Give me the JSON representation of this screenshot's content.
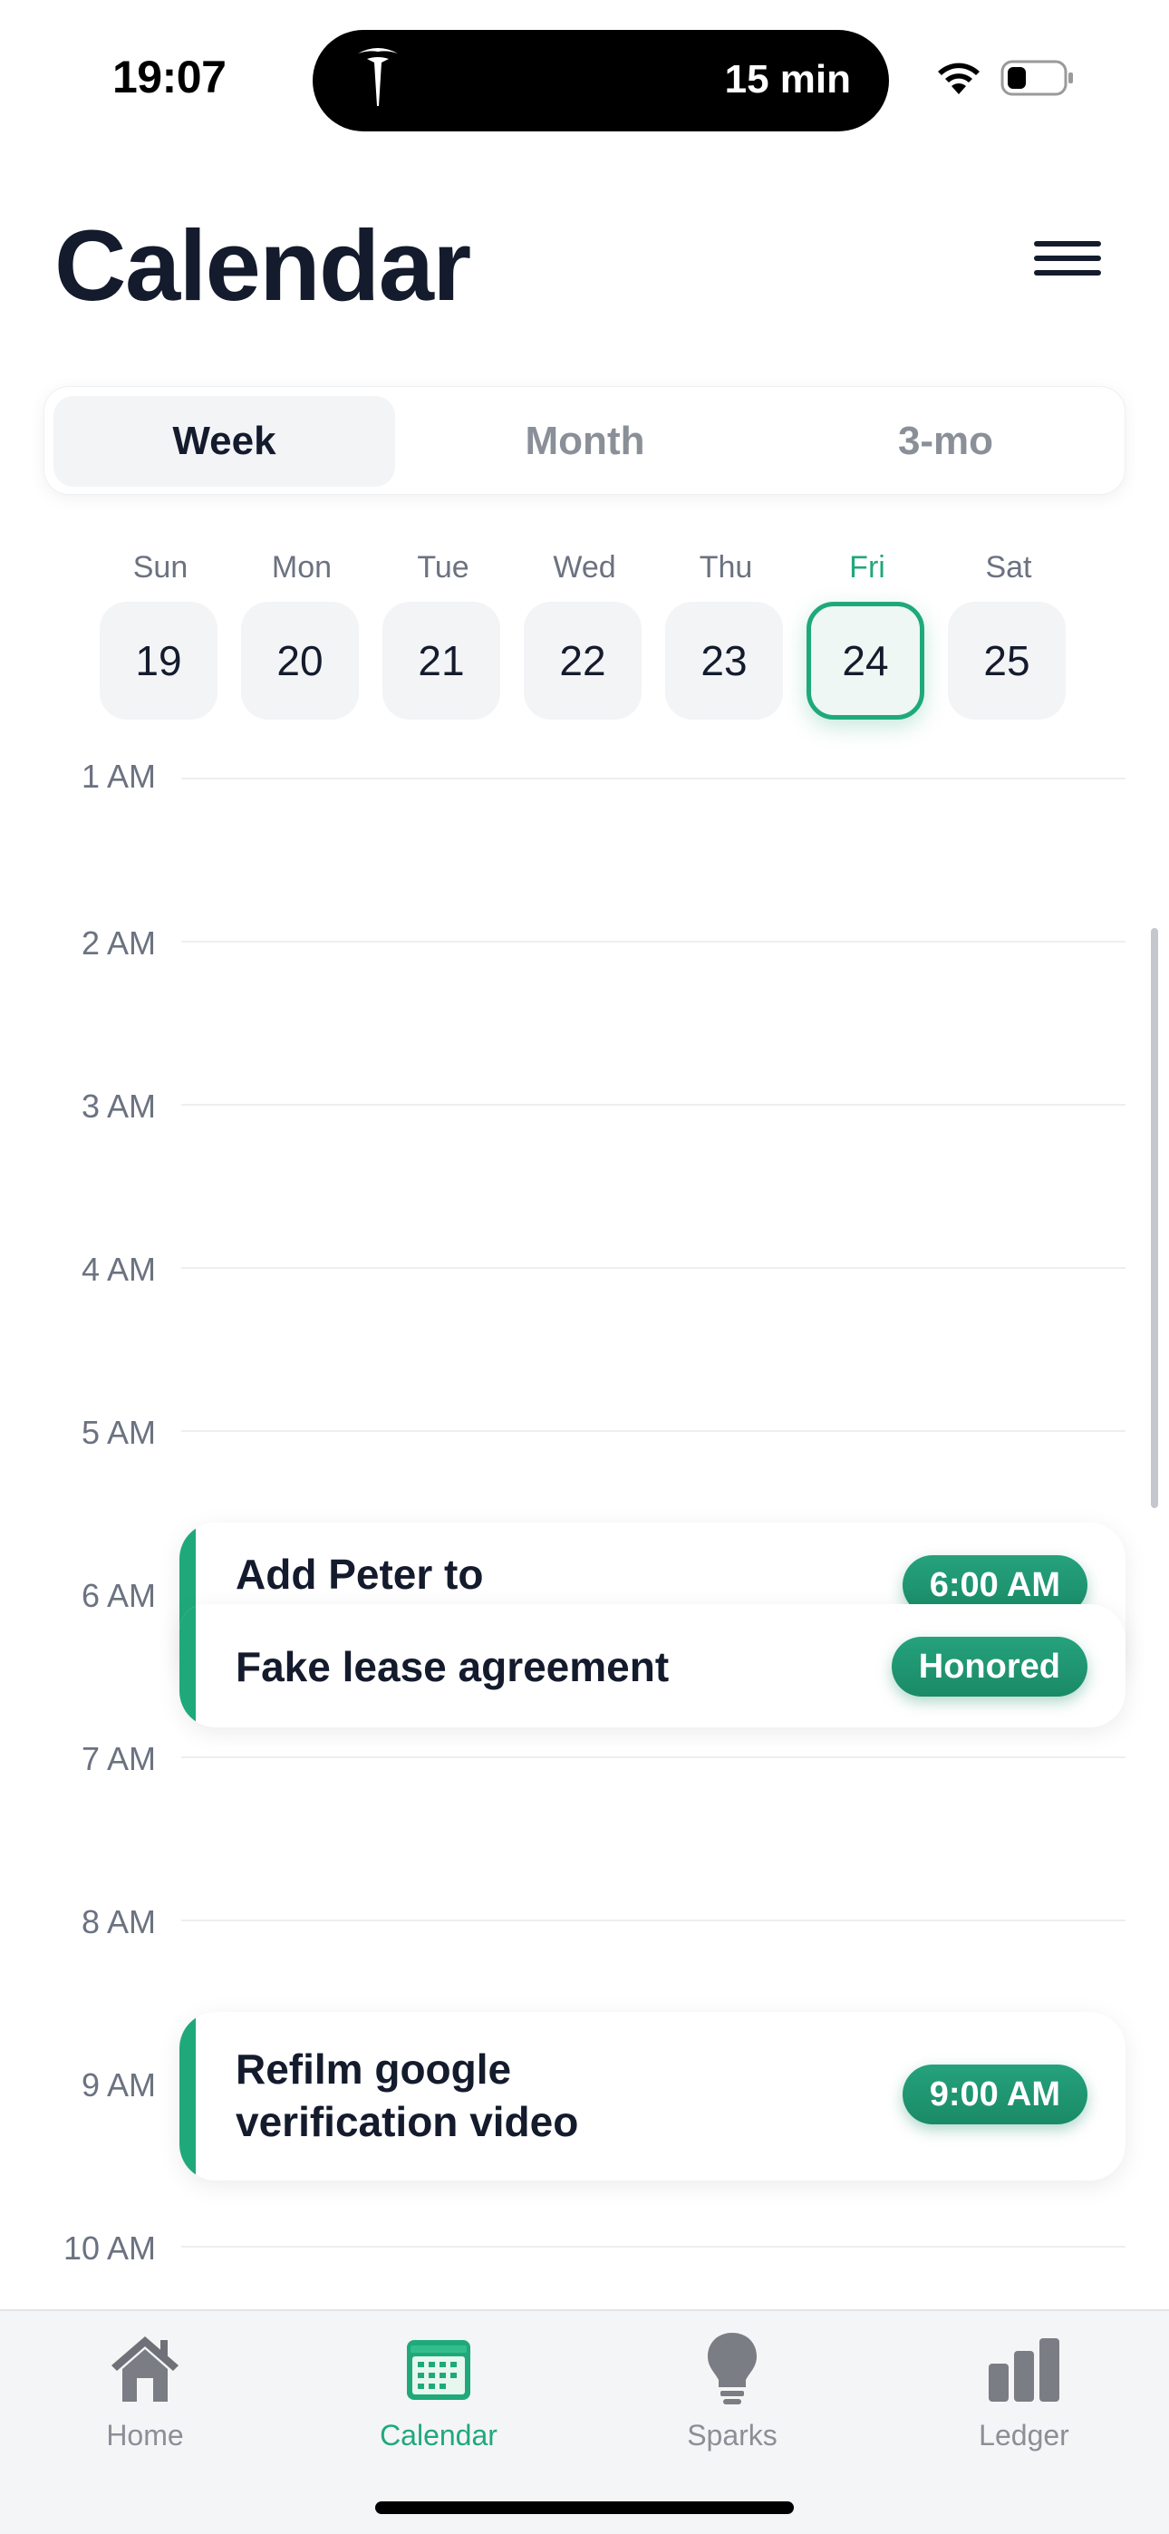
{
  "status_bar": {
    "time": "19:07",
    "island_text": "15 min",
    "icons": [
      "tesla-logo-icon",
      "wifi-icon",
      "battery-icon"
    ]
  },
  "header": {
    "title": "Calendar",
    "menu_icon": "hamburger-menu-icon"
  },
  "view_switcher": {
    "options": [
      "Week",
      "Month",
      "3-mo"
    ],
    "selected": "Week"
  },
  "week": {
    "days": [
      {
        "dow": "Sun",
        "num": "19"
      },
      {
        "dow": "Mon",
        "num": "20"
      },
      {
        "dow": "Tue",
        "num": "21"
      },
      {
        "dow": "Wed",
        "num": "22"
      },
      {
        "dow": "Thu",
        "num": "23"
      },
      {
        "dow": "Fri",
        "num": "24"
      },
      {
        "dow": "Sat",
        "num": "25"
      }
    ],
    "selected": "24"
  },
  "timeline": {
    "hours": [
      "1 AM",
      "2 AM",
      "3 AM",
      "4 AM",
      "5 AM",
      "6 AM",
      "7 AM",
      "8 AM",
      "9 AM",
      "10 AM"
    ],
    "events": [
      {
        "title": "Add Peter to",
        "badge": "6:00 AM"
      },
      {
        "title": "Fake lease agreement",
        "badge": "Honored"
      },
      {
        "title": "Refilm google verification video",
        "title_line1": "Refilm google",
        "title_line2": "verification video",
        "badge": "9:00 AM"
      }
    ]
  },
  "tabbar": {
    "tabs": [
      {
        "label": "Home",
        "icon": "home-icon"
      },
      {
        "label": "Calendar",
        "icon": "calendar-icon"
      },
      {
        "label": "Sparks",
        "icon": "lightbulb-icon"
      },
      {
        "label": "Ledger",
        "icon": "bar-chart-icon"
      }
    ],
    "active": "Calendar"
  },
  "colors": {
    "accent": "#1fa97a",
    "text": "#141b2d",
    "muted": "#8a8f98"
  }
}
